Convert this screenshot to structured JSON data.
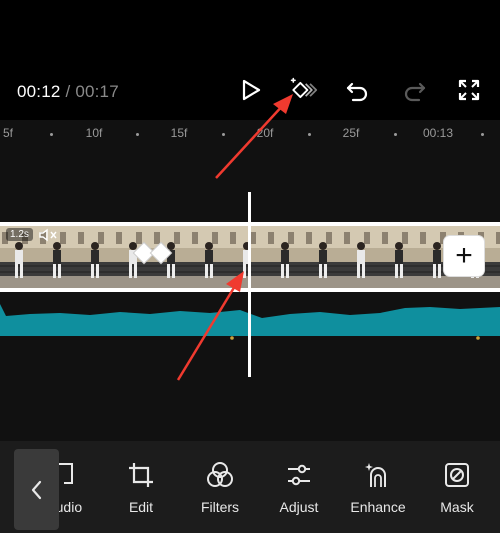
{
  "player": {
    "current_time": "00:12",
    "separator": " / ",
    "total_time": "00:17"
  },
  "ruler": {
    "ticks": [
      "5f",
      "10f",
      "15f",
      "20f",
      "25f",
      "00:13"
    ]
  },
  "clip": {
    "duration_badge": "1.2s"
  },
  "toolbar": {
    "items": [
      {
        "label": "audio",
        "icon": "extract-audio-icon"
      },
      {
        "label": "Edit",
        "icon": "crop-icon"
      },
      {
        "label": "Filters",
        "icon": "filters-icon"
      },
      {
        "label": "Adjust",
        "icon": "adjust-sliders-icon"
      },
      {
        "label": "Enhance",
        "icon": "enhance-icon"
      },
      {
        "label": "Mask",
        "icon": "mask-icon"
      }
    ]
  },
  "colors": {
    "audio_waveform": "#0f8f9e",
    "annotation_arrow": "#f03a2f",
    "toolbar_bg": "#1c1c1c"
  }
}
